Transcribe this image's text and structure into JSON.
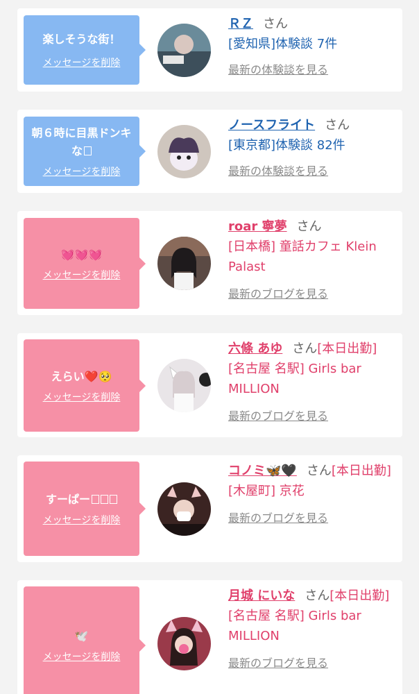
{
  "delete_label": "メッセージを削除",
  "san": "さん",
  "colors": {
    "blue_bubble": "#87b8f2",
    "pink_bubble": "#f690a6",
    "blue_text": "#1f63b0",
    "pink_text": "#e0406b"
  },
  "items": [
    {
      "message": "楽しそうな街！",
      "name": "ＲＺ",
      "line1": "[愛知県]体験談 7件",
      "line2": "",
      "more": "最新の体験談を見る",
      "avatar": "avatar-image"
    },
    {
      "message": "朝６時に目黒ドンキな",
      "name": "ノースフライト",
      "line1": "[東京都]体験談 82件",
      "line2": "",
      "more": "最新の体験談を見る",
      "avatar": "kuromi-avatar-image"
    },
    {
      "message": "💓💓💓",
      "name": "𝗿𝗼𝗮𝗿 寧夢",
      "line1": "[日本橋] 童話カフェ Klein Palast",
      "line2": "",
      "more": "最新のブログを見る",
      "avatar": "avatar-image"
    },
    {
      "message": "えらい❤️🥺",
      "name": "六條 あゆ",
      "suffix": "[本日出勤]",
      "line1": "[名古屋 名駅] Girls bar MILLION",
      "line2": "",
      "more": "最新のブログを見る",
      "avatar": "avatar-image"
    },
    {
      "message": "すーぱー",
      "name": "コノミ🦋🖤",
      "suffix": "[本日出勤]",
      "line1": "[木屋町] 京花",
      "line2": "",
      "more": "最新のブログを見る",
      "avatar": "avatar-image"
    },
    {
      "message": "🕊️",
      "name": "月城 にいな",
      "suffix": "[本日出勤]",
      "line1": "[名古屋 名駅] Girls bar MILLION",
      "line2": "",
      "more": "最新のブログを見る",
      "avatar": "avatar-image"
    }
  ]
}
